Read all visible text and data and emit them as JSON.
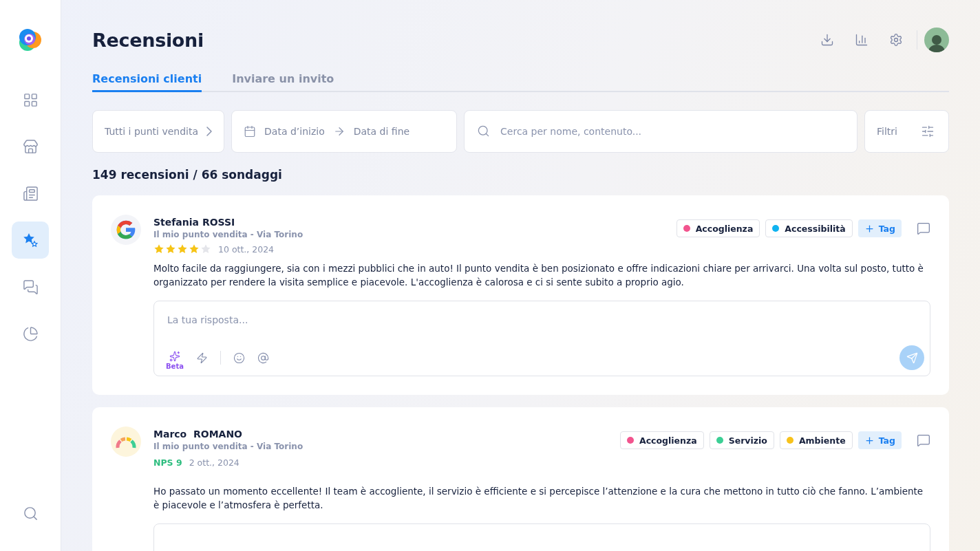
{
  "sidebar": {
    "items": [
      {
        "selected": false
      },
      {
        "selected": false
      },
      {
        "selected": false
      },
      {
        "selected": true
      },
      {
        "selected": false
      },
      {
        "selected": false
      }
    ]
  },
  "page": {
    "title": "Recensioni"
  },
  "tabs": [
    {
      "label": "Recensioni clienti",
      "selected": true
    },
    {
      "label": "Inviare un invito",
      "selected": false
    }
  ],
  "filters": {
    "stores": "Tutti i punti vendita",
    "start_date": "Data d’inizio",
    "end_date": "Data di fine",
    "search_placeholder": "Cerca per nome, contenuto...",
    "filters_label": "Filtri"
  },
  "summary": "149 recensioni / 66 sondaggi",
  "reviews": [
    {
      "kind": "rating",
      "author": "Stefania ROSSI",
      "store": "Il mio punto vendita - Via Torino",
      "stars": 4,
      "date": "10 ott., 2024",
      "tags": [
        {
          "label": "Accoglienza",
          "color": "#f2548e"
        },
        {
          "label": "Accessibilità",
          "color": "#10b3f0"
        }
      ],
      "add_tag": "Tag",
      "text": "Molto facile da raggiungere, sia con i mezzi pubblici che in auto! Il punto vendita è ben posizionato e offre indicazioni chiare per arrivarci. Una volta sul posto, tutto è organizzato per rendere la visita semplice e piacevole. L'accoglienza è calorosa e ci si sente subito a proprio agio.",
      "reply_placeholder": "La tua risposta...",
      "ai_label": "Beta"
    },
    {
      "kind": "nps",
      "author": "Marco  ROMANO",
      "store": "Il mio punto vendita - Via Torino",
      "score": "NPS 9",
      "date": "2 ott., 2024",
      "tags": [
        {
          "label": "Accoglienza",
          "color": "#f2548e"
        },
        {
          "label": "Servizio",
          "color": "#3ccf95"
        },
        {
          "label": "Ambiente",
          "color": "#f7c21b"
        }
      ],
      "add_tag": "Tag",
      "text": "Ho passato un momento eccellente! Il team è accogliente, il servizio è efficiente e si percepisce l’attenzione e la cura che mettono in tutto ciò che fanno. L’ambiente è piacevole e l’atmosfera è perfetta."
    }
  ]
}
